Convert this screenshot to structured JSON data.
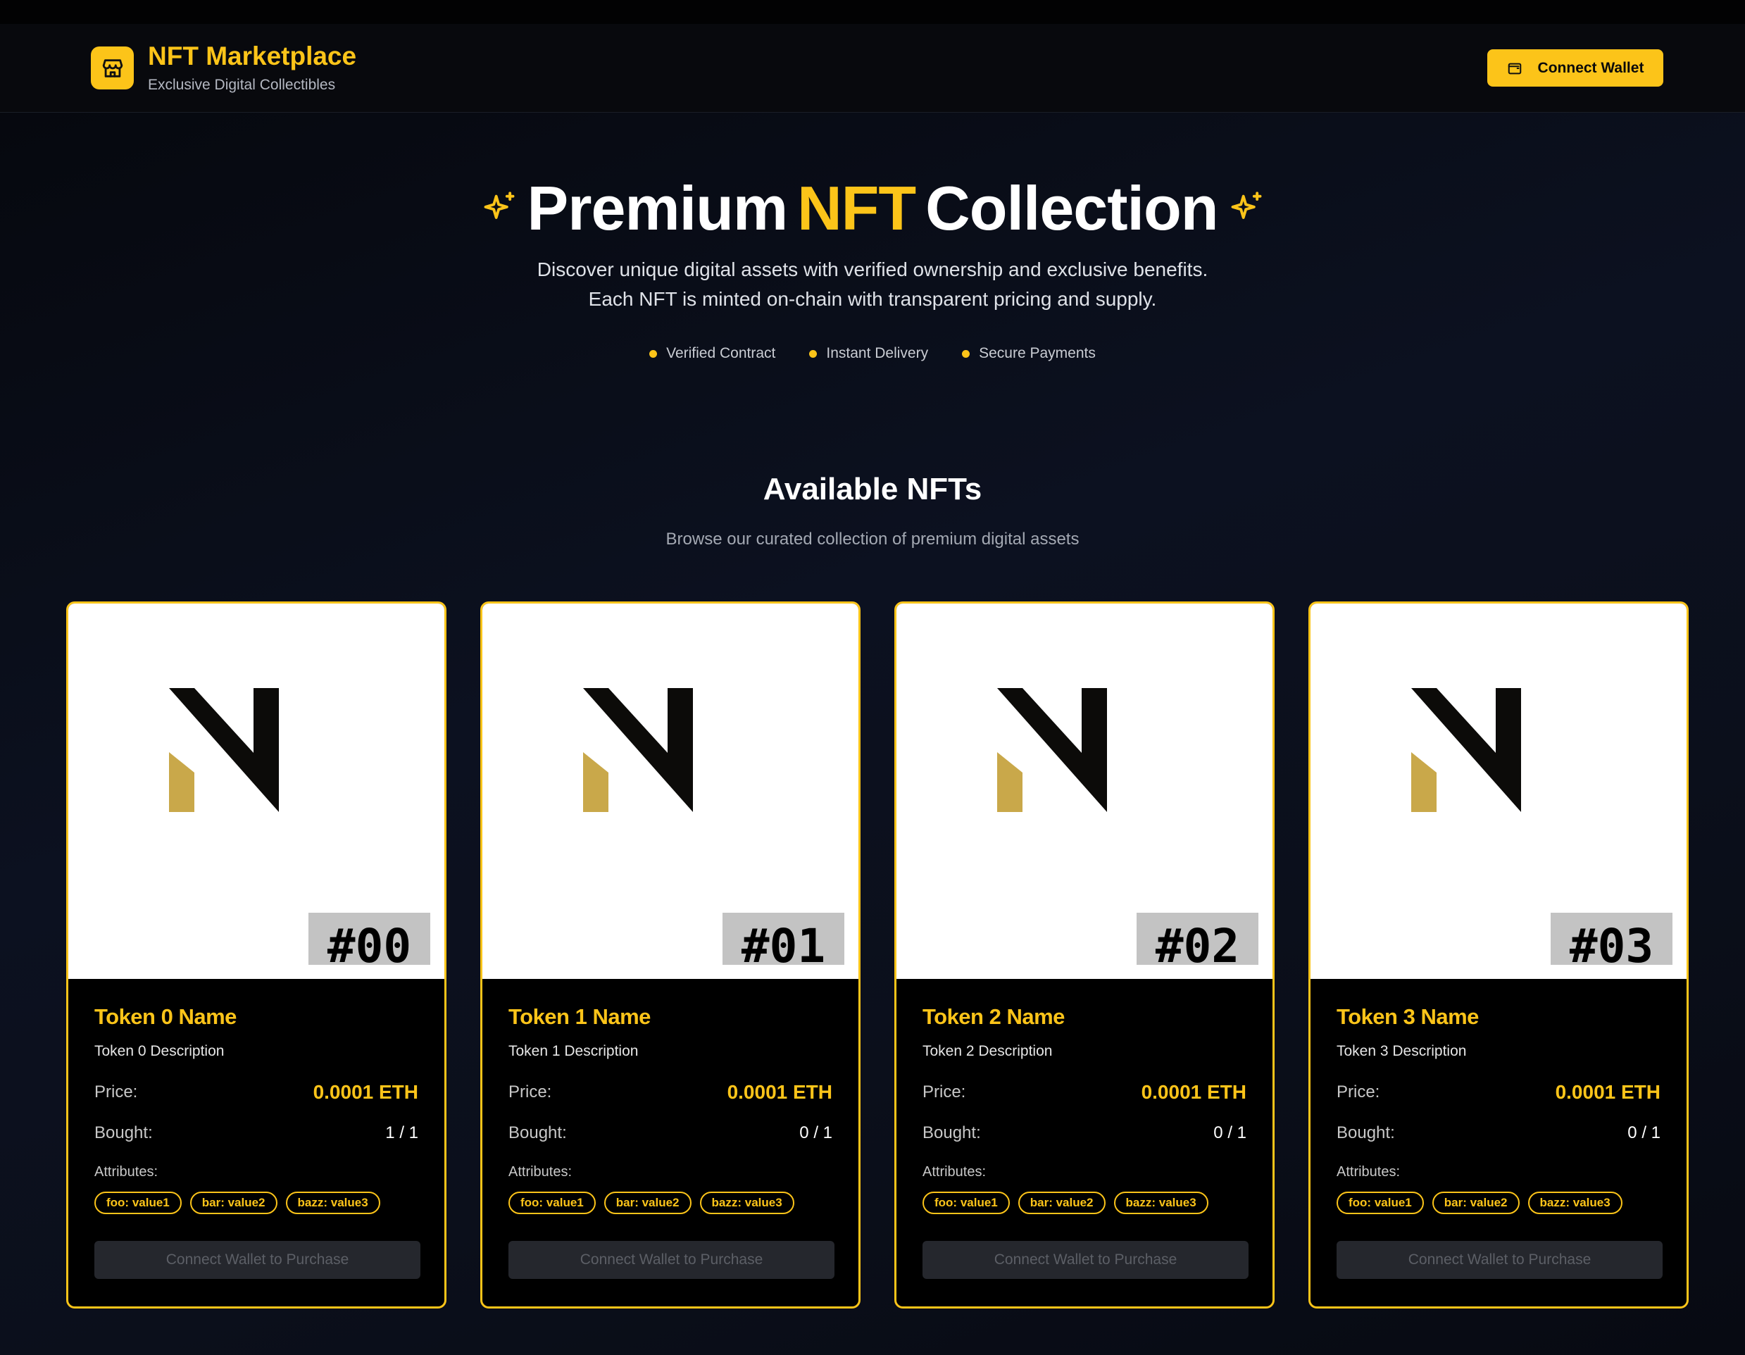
{
  "header": {
    "title": "NFT Marketplace",
    "subtitle": "Exclusive Digital Collectibles",
    "connect_label": "Connect Wallet",
    "store_icon": "store-icon",
    "wallet_icon": "wallet-icon"
  },
  "hero": {
    "title_part1": "Premium",
    "title_accent": "NFT",
    "title_part2": "Collection",
    "desc_line1": "Discover unique digital assets with verified ownership and exclusive benefits.",
    "desc_line2": "Each NFT is minted on-chain with transparent pricing and supply.",
    "features": [
      "Verified Contract",
      "Instant Delivery",
      "Secure Payments"
    ],
    "icon": "sparkles-icon"
  },
  "section": {
    "title": "Available NFTs",
    "subtitle": "Browse our curated collection of premium digital assets"
  },
  "labels": {
    "price": "Price:",
    "bought": "Bought:",
    "attributes": "Attributes:",
    "purchase": "Connect Wallet to Purchase"
  },
  "tokens": [
    {
      "tag": "#00",
      "name": "Token 0 Name",
      "description": "Token 0 Description",
      "price": "0.0001 ETH",
      "bought": "1 / 1",
      "attributes": [
        "foo: value1",
        "bar: value2",
        "bazz: value3"
      ]
    },
    {
      "tag": "#01",
      "name": "Token 1 Name",
      "description": "Token 1 Description",
      "price": "0.0001 ETH",
      "bought": "0 / 1",
      "attributes": [
        "foo: value1",
        "bar: value2",
        "bazz: value3"
      ]
    },
    {
      "tag": "#02",
      "name": "Token 2 Name",
      "description": "Token 2 Description",
      "price": "0.0001 ETH",
      "bought": "0 / 1",
      "attributes": [
        "foo: value1",
        "bar: value2",
        "bazz: value3"
      ]
    },
    {
      "tag": "#03",
      "name": "Token 3 Name",
      "description": "Token 3 Description",
      "price": "0.0001 ETH",
      "bought": "0 / 1",
      "attributes": [
        "foo: value1",
        "bar: value2",
        "bazz: value3"
      ]
    }
  ],
  "colors": {
    "accent": "#fcc419",
    "logo_dark": "#0c0b09",
    "logo_gold": "#c9a84a"
  }
}
